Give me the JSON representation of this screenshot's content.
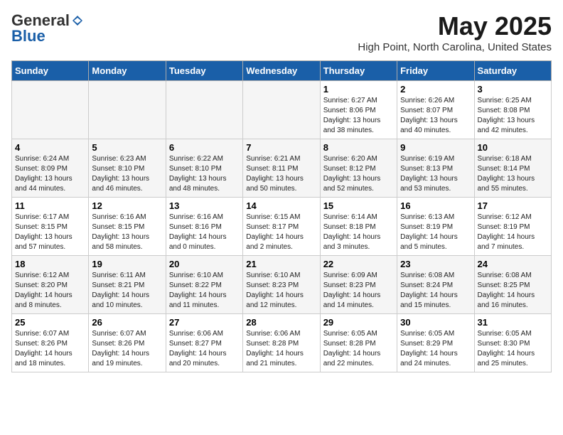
{
  "header": {
    "logo_general": "General",
    "logo_blue": "Blue",
    "month_title": "May 2025",
    "location": "High Point, North Carolina, United States"
  },
  "weekdays": [
    "Sunday",
    "Monday",
    "Tuesday",
    "Wednesday",
    "Thursday",
    "Friday",
    "Saturday"
  ],
  "weeks": [
    [
      {
        "day": "",
        "info": ""
      },
      {
        "day": "",
        "info": ""
      },
      {
        "day": "",
        "info": ""
      },
      {
        "day": "",
        "info": ""
      },
      {
        "day": "1",
        "info": "Sunrise: 6:27 AM\nSunset: 8:06 PM\nDaylight: 13 hours\nand 38 minutes."
      },
      {
        "day": "2",
        "info": "Sunrise: 6:26 AM\nSunset: 8:07 PM\nDaylight: 13 hours\nand 40 minutes."
      },
      {
        "day": "3",
        "info": "Sunrise: 6:25 AM\nSunset: 8:08 PM\nDaylight: 13 hours\nand 42 minutes."
      }
    ],
    [
      {
        "day": "4",
        "info": "Sunrise: 6:24 AM\nSunset: 8:09 PM\nDaylight: 13 hours\nand 44 minutes."
      },
      {
        "day": "5",
        "info": "Sunrise: 6:23 AM\nSunset: 8:10 PM\nDaylight: 13 hours\nand 46 minutes."
      },
      {
        "day": "6",
        "info": "Sunrise: 6:22 AM\nSunset: 8:10 PM\nDaylight: 13 hours\nand 48 minutes."
      },
      {
        "day": "7",
        "info": "Sunrise: 6:21 AM\nSunset: 8:11 PM\nDaylight: 13 hours\nand 50 minutes."
      },
      {
        "day": "8",
        "info": "Sunrise: 6:20 AM\nSunset: 8:12 PM\nDaylight: 13 hours\nand 52 minutes."
      },
      {
        "day": "9",
        "info": "Sunrise: 6:19 AM\nSunset: 8:13 PM\nDaylight: 13 hours\nand 53 minutes."
      },
      {
        "day": "10",
        "info": "Sunrise: 6:18 AM\nSunset: 8:14 PM\nDaylight: 13 hours\nand 55 minutes."
      }
    ],
    [
      {
        "day": "11",
        "info": "Sunrise: 6:17 AM\nSunset: 8:15 PM\nDaylight: 13 hours\nand 57 minutes."
      },
      {
        "day": "12",
        "info": "Sunrise: 6:16 AM\nSunset: 8:15 PM\nDaylight: 13 hours\nand 58 minutes."
      },
      {
        "day": "13",
        "info": "Sunrise: 6:16 AM\nSunset: 8:16 PM\nDaylight: 14 hours\nand 0 minutes."
      },
      {
        "day": "14",
        "info": "Sunrise: 6:15 AM\nSunset: 8:17 PM\nDaylight: 14 hours\nand 2 minutes."
      },
      {
        "day": "15",
        "info": "Sunrise: 6:14 AM\nSunset: 8:18 PM\nDaylight: 14 hours\nand 3 minutes."
      },
      {
        "day": "16",
        "info": "Sunrise: 6:13 AM\nSunset: 8:19 PM\nDaylight: 14 hours\nand 5 minutes."
      },
      {
        "day": "17",
        "info": "Sunrise: 6:12 AM\nSunset: 8:19 PM\nDaylight: 14 hours\nand 7 minutes."
      }
    ],
    [
      {
        "day": "18",
        "info": "Sunrise: 6:12 AM\nSunset: 8:20 PM\nDaylight: 14 hours\nand 8 minutes."
      },
      {
        "day": "19",
        "info": "Sunrise: 6:11 AM\nSunset: 8:21 PM\nDaylight: 14 hours\nand 10 minutes."
      },
      {
        "day": "20",
        "info": "Sunrise: 6:10 AM\nSunset: 8:22 PM\nDaylight: 14 hours\nand 11 minutes."
      },
      {
        "day": "21",
        "info": "Sunrise: 6:10 AM\nSunset: 8:23 PM\nDaylight: 14 hours\nand 12 minutes."
      },
      {
        "day": "22",
        "info": "Sunrise: 6:09 AM\nSunset: 8:23 PM\nDaylight: 14 hours\nand 14 minutes."
      },
      {
        "day": "23",
        "info": "Sunrise: 6:08 AM\nSunset: 8:24 PM\nDaylight: 14 hours\nand 15 minutes."
      },
      {
        "day": "24",
        "info": "Sunrise: 6:08 AM\nSunset: 8:25 PM\nDaylight: 14 hours\nand 16 minutes."
      }
    ],
    [
      {
        "day": "25",
        "info": "Sunrise: 6:07 AM\nSunset: 8:26 PM\nDaylight: 14 hours\nand 18 minutes."
      },
      {
        "day": "26",
        "info": "Sunrise: 6:07 AM\nSunset: 8:26 PM\nDaylight: 14 hours\nand 19 minutes."
      },
      {
        "day": "27",
        "info": "Sunrise: 6:06 AM\nSunset: 8:27 PM\nDaylight: 14 hours\nand 20 minutes."
      },
      {
        "day": "28",
        "info": "Sunrise: 6:06 AM\nSunset: 8:28 PM\nDaylight: 14 hours\nand 21 minutes."
      },
      {
        "day": "29",
        "info": "Sunrise: 6:05 AM\nSunset: 8:28 PM\nDaylight: 14 hours\nand 22 minutes."
      },
      {
        "day": "30",
        "info": "Sunrise: 6:05 AM\nSunset: 8:29 PM\nDaylight: 14 hours\nand 24 minutes."
      },
      {
        "day": "31",
        "info": "Sunrise: 6:05 AM\nSunset: 8:30 PM\nDaylight: 14 hours\nand 25 minutes."
      }
    ]
  ]
}
